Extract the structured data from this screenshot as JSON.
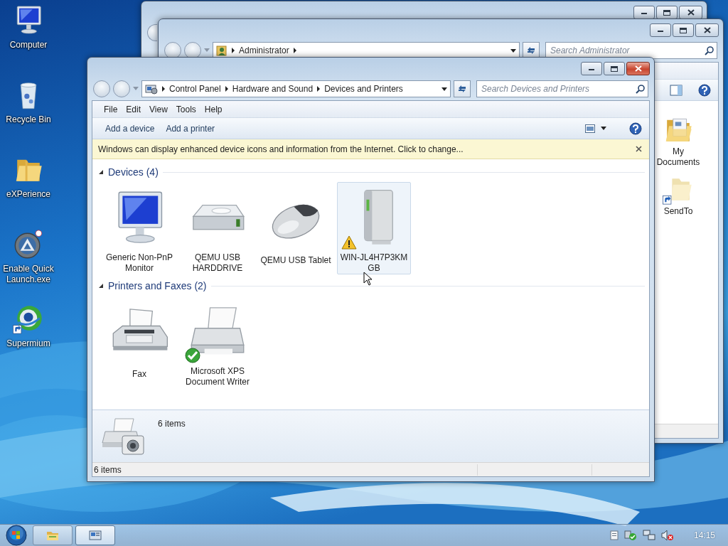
{
  "desktop_icons": [
    {
      "label": "Computer",
      "kind": "computer"
    },
    {
      "label": "Recycle Bin",
      "kind": "recycle-bin"
    },
    {
      "label": "eXPerience",
      "kind": "folder"
    },
    {
      "label": "Enable Quick Launch.exe",
      "kind": "app"
    },
    {
      "label": "Supermium",
      "kind": "browser"
    }
  ],
  "windows": [
    {
      "kind": "blank",
      "active": false
    },
    {
      "kind": "folder",
      "active": false,
      "address": [
        "Administrator"
      ],
      "subfolders": true,
      "search": {
        "placeholder": "Search Administrator"
      },
      "items": [
        {
          "label": "My Documents",
          "kind": "documents-folder"
        },
        {
          "label": "SendTo",
          "kind": "shortcut-folder"
        }
      ]
    },
    {
      "kind": "devices",
      "active": true,
      "address": [
        "Control Panel",
        "Hardware and Sound",
        "Devices and Printers"
      ],
      "subfolders": false,
      "search": {
        "placeholder": "Search Devices and Printers"
      },
      "menu": [
        "File",
        "Edit",
        "View",
        "Tools",
        "Help"
      ],
      "commands": [
        "Add a device",
        "Add a printer"
      ],
      "infobar": "Windows can display enhanced device icons and information from the Internet. Click to change...",
      "groups": [
        {
          "title": "Devices (4)",
          "expanded": true,
          "items": [
            {
              "label": "Generic Non-PnP Monitor",
              "kind": "monitor",
              "selected": false
            },
            {
              "label": "QEMU USB HARDDRIVE",
              "kind": "harddrive",
              "selected": false
            },
            {
              "label": "QEMU USB Tablet",
              "kind": "mouse",
              "selected": false
            },
            {
              "label": "WIN-JL4H7P3KM GB",
              "kind": "tower",
              "selected": true,
              "warning": true
            }
          ]
        },
        {
          "title": "Printers and Faxes (2)",
          "expanded": true,
          "items": [
            {
              "label": "Fax",
              "kind": "fax",
              "selected": false
            },
            {
              "label": "Microsoft XPS Document Writer",
              "kind": "printer",
              "selected": false,
              "default": true
            }
          ]
        }
      ],
      "details": "6 items",
      "status_bar": "6 items"
    }
  ],
  "taskbar": {
    "buttons": [
      {
        "selected": false
      },
      {
        "selected": true
      }
    ],
    "clock": "14:15"
  }
}
